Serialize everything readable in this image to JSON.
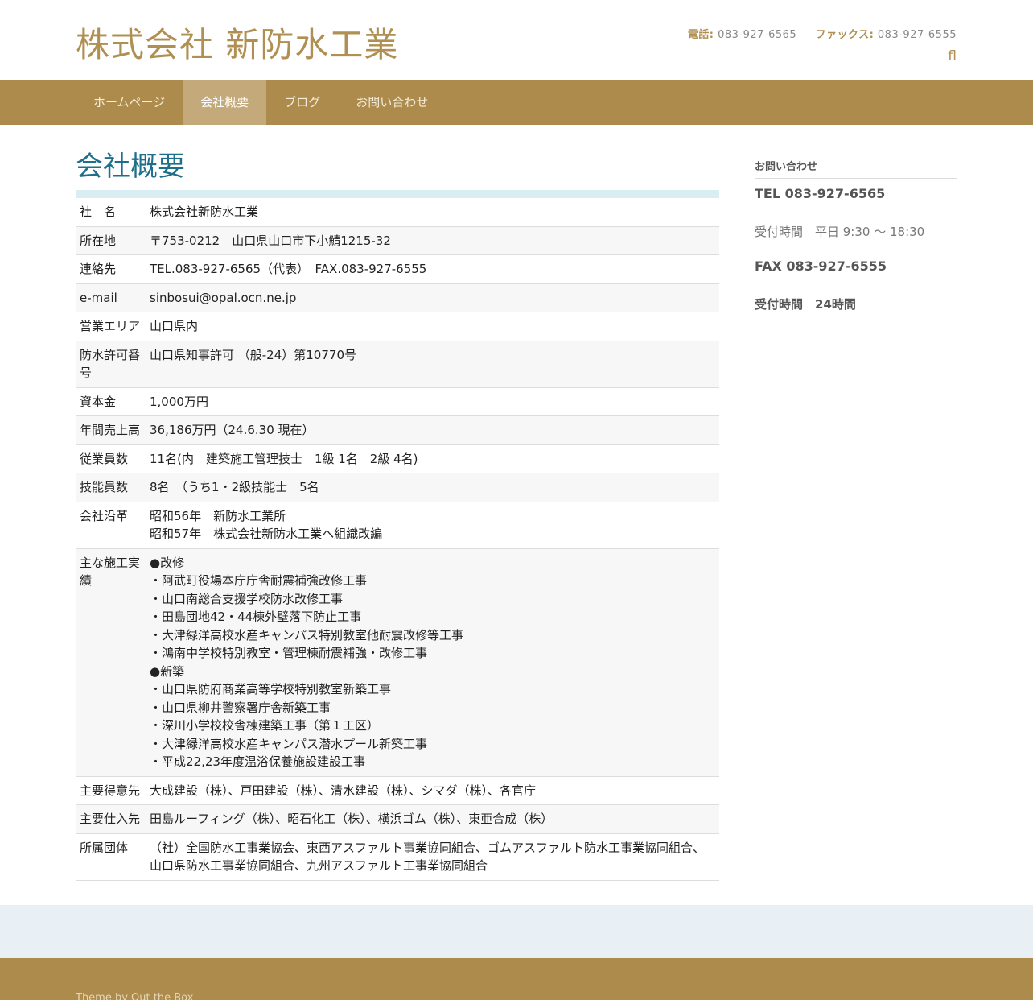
{
  "header": {
    "site_title": "株式会社 新防水工業",
    "phone_label": "電話:",
    "phone": "083-927-6565",
    "fax_label": "ファックス:",
    "fax": "083-927-6555",
    "social_icon_glyph": "fl",
    "social_icon": "flickr-icon"
  },
  "nav": {
    "items": [
      {
        "label": "ホームページ",
        "active": false
      },
      {
        "label": "会社概要",
        "active": true
      },
      {
        "label": "ブログ",
        "active": false
      },
      {
        "label": "お問い合わせ",
        "active": false
      }
    ]
  },
  "main": {
    "title": "会社概要",
    "rows": [
      {
        "key": "社　名",
        "lines": [
          "株式会社新防水工業"
        ]
      },
      {
        "key": "所在地",
        "lines": [
          "〒753-0212　山口県山口市下小鯖1215-32"
        ]
      },
      {
        "key": "連絡先",
        "lines": [
          "TEL.083-927-6565（代表）　FAX.083-927-6555"
        ]
      },
      {
        "key": "e-mail",
        "lines": [
          "sinbosui@opal.ocn.ne.jp"
        ]
      },
      {
        "key": "営業エリア",
        "lines": [
          "山口県内"
        ]
      },
      {
        "key": "防水許可番号",
        "lines": [
          "山口県知事許可 （般-24）第10770号"
        ]
      },
      {
        "key": "資本金",
        "lines": [
          "1,000万円"
        ]
      },
      {
        "key": "年間売上高",
        "lines": [
          "36,186万円（24.6.30 現在）"
        ]
      },
      {
        "key": "従業員数",
        "lines": [
          "11名(内　建築施工管理技士　1級 1名　2級 4名)"
        ]
      },
      {
        "key": "技能員数",
        "lines": [
          "8名　（うち1・2級技能士　5名"
        ]
      },
      {
        "key": "会社沿革",
        "lines": [
          "昭和56年　新防水工業所",
          "昭和57年　株式会社新防水工業へ組織改編"
        ]
      },
      {
        "key": "主な施工実績",
        "lines": [
          "●改修",
          "・阿武町役場本庁庁舎耐震補強改修工事",
          "・山口南総合支援学校防水改修工事",
          "・田島団地42・44棟外壁落下防止工事",
          "・大津緑洋高校水産キャンパス特別教室他耐震改修等工事",
          "・鴻南中学校特別教室・管理棟耐震補強・改修工事",
          "●新築",
          "・山口県防府商業高等学校特別教室新築工事",
          "・山口県柳井警察署庁舎新築工事",
          "・深川小学校校舎棟建築工事（第１工区）",
          "・大津緑洋高校水産キャンパス潜水プール新築工事",
          "・平成22,23年度温浴保養施設建設工事"
        ]
      },
      {
        "key": "主要得意先",
        "lines": [
          "大成建設（株）、戸田建設（株）、清水建設（株）、シマダ（株）、各官庁"
        ]
      },
      {
        "key": "主要仕入先",
        "lines": [
          "田島ルーフィング（株）、昭石化工（株）、横浜ゴム（株）、東亜合成（株）"
        ]
      },
      {
        "key": "所属団体",
        "lines": [
          "（社）全国防水工事業協会、東西アスファルト事業協同組合、ゴムアスファルト防水工事業協同組合、",
          "山口県防水工事業協同組合、九州アスファルト工事業協同組合"
        ]
      }
    ]
  },
  "sidebar": {
    "heading": "お問い合わせ",
    "tel": "TEL 083-927-6565",
    "hours": "受付時間　平日 9:30 〜 18:30",
    "fax": "FAX 083-927-6555",
    "fax_hours": "受付時間　24時間"
  },
  "footer": {
    "credit": "Theme by Out the Box"
  },
  "colors": {
    "brand_gold": "#ac8b4d",
    "title_gold": "#b08f52",
    "heading_blue": "#1e6f8c",
    "table_top_bar": "#d9edf3",
    "prefooter": "#e8eff5"
  }
}
